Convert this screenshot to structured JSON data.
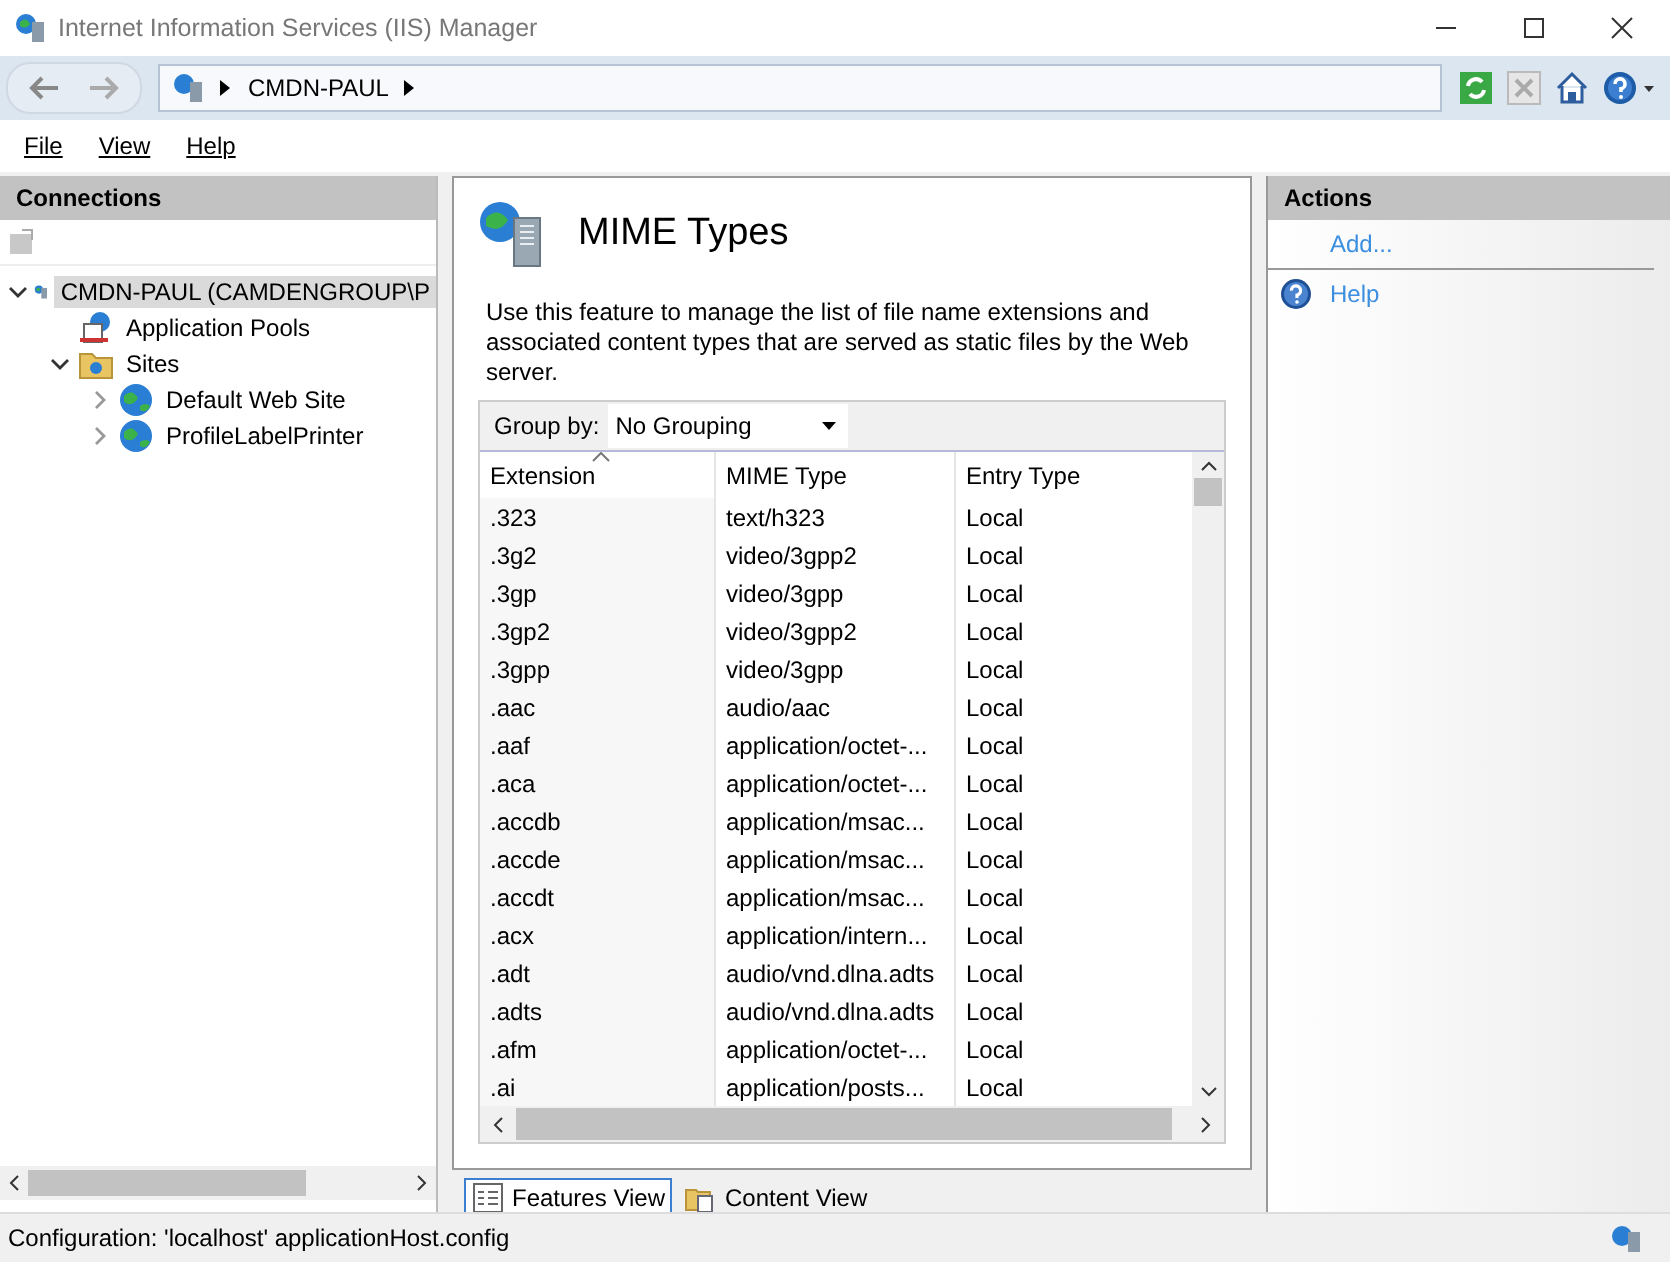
{
  "window": {
    "title": "Internet Information Services (IIS) Manager"
  },
  "address_bar": {
    "segments": [
      "CMDN-PAUL"
    ]
  },
  "menu": [
    "File",
    "View",
    "Help"
  ],
  "connections": {
    "title": "Connections",
    "tree": [
      {
        "label": "CMDN-PAUL (CAMDENGROUP\\P",
        "kind": "server",
        "expanded": true,
        "selected": true,
        "children": [
          {
            "label": "Application Pools",
            "kind": "pool",
            "selected": false
          },
          {
            "label": "Sites",
            "kind": "folder",
            "expanded": true,
            "selected": false,
            "children": [
              {
                "label": "Default Web Site",
                "kind": "site",
                "expanded": false,
                "selected": false
              },
              {
                "label": "ProfileLabelPrinter",
                "kind": "site",
                "expanded": false,
                "selected": false
              }
            ]
          }
        ]
      }
    ]
  },
  "feature": {
    "title": "MIME Types",
    "description": "Use this feature to manage the list of file name extensions and associated content types that are served as static files by the Web server.",
    "group_by": {
      "label": "Group by:",
      "value": "No Grouping"
    },
    "table": {
      "columns": [
        {
          "label": "Extension",
          "sorted": true
        },
        {
          "label": "MIME Type",
          "sorted": false
        },
        {
          "label": "Entry Type",
          "sorted": false
        }
      ],
      "rows": [
        [
          ".323",
          "text/h323",
          "Local"
        ],
        [
          ".3g2",
          "video/3gpp2",
          "Local"
        ],
        [
          ".3gp",
          "video/3gpp",
          "Local"
        ],
        [
          ".3gp2",
          "video/3gpp2",
          "Local"
        ],
        [
          ".3gpp",
          "video/3gpp",
          "Local"
        ],
        [
          ".aac",
          "audio/aac",
          "Local"
        ],
        [
          ".aaf",
          "application/octet-...",
          "Local"
        ],
        [
          ".aca",
          "application/octet-...",
          "Local"
        ],
        [
          ".accdb",
          "application/msac...",
          "Local"
        ],
        [
          ".accde",
          "application/msac...",
          "Local"
        ],
        [
          ".accdt",
          "application/msac...",
          "Local"
        ],
        [
          ".acx",
          "application/intern...",
          "Local"
        ],
        [
          ".adt",
          "audio/vnd.dlna.adts",
          "Local"
        ],
        [
          ".adts",
          "audio/vnd.dlna.adts",
          "Local"
        ],
        [
          ".afm",
          "application/octet-...",
          "Local"
        ],
        [
          ".ai",
          "application/posts...",
          "Local"
        ]
      ]
    }
  },
  "view_tabs": [
    {
      "label": "Features View",
      "selected": true
    },
    {
      "label": "Content View",
      "selected": false
    }
  ],
  "actions": {
    "title": "Actions",
    "items": [
      "Add...",
      "Help"
    ]
  },
  "status_bar": {
    "text": "Configuration: 'localhost' applicationHost.config"
  }
}
